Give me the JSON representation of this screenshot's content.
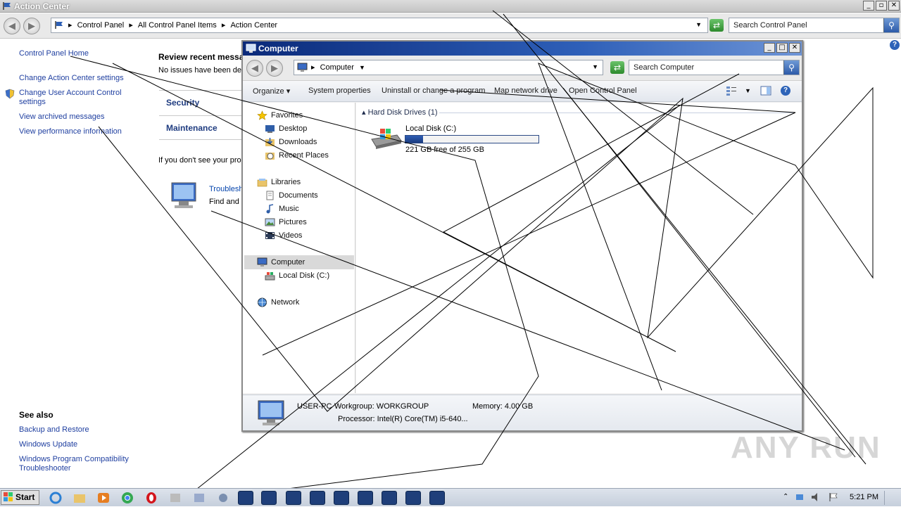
{
  "ac_window": {
    "title": "Action Center",
    "breadcrumbs": [
      "Control Panel",
      "All Control Panel Items",
      "Action Center"
    ],
    "search_placeholder": "Search Control Panel",
    "left_links": {
      "home": "Control Panel Home",
      "change_settings": "Change Action Center settings",
      "uac": "Change User Account Control settings",
      "archived": "View archived messages",
      "performance": "View performance information"
    },
    "see_also": {
      "title": "See also",
      "backup": "Backup and Restore",
      "update": "Windows Update",
      "compat": "Windows Program Compatibility Troubleshooter"
    },
    "main": {
      "review_title": "Review recent messa",
      "no_issues": "No issues have been det",
      "security": "Security",
      "maintenance": "Maintenance",
      "dont_see": "If you don't see your pro",
      "troubleshoot_title": "Troublesh",
      "troubleshoot_desc": "Find and"
    }
  },
  "computer_window": {
    "title": "Computer",
    "address": "Computer",
    "search_placeholder": "Search Computer",
    "toolbar": {
      "organize": "Organize",
      "system_properties": "System properties",
      "uninstall": "Uninstall or change a program",
      "map_drive": "Map network drive",
      "open_cp": "Open Control Panel"
    },
    "nav": {
      "favorites": "Favorites",
      "desktop": "Desktop",
      "downloads": "Downloads",
      "recent": "Recent Places",
      "libraries": "Libraries",
      "documents": "Documents",
      "music": "Music",
      "pictures": "Pictures",
      "videos": "Videos",
      "computer": "Computer",
      "local_disk": "Local Disk (C:)",
      "network": "Network"
    },
    "group_header": "Hard Disk Drives (1)",
    "drive": {
      "name": "Local Disk (C:)",
      "free_text": "221 GB free of 255 GB",
      "used_fraction": 0.13
    },
    "details": {
      "pc_name": "USER-PC",
      "workgroup": "Workgroup: WORKGROUP",
      "memory": "Memory: 4.00 GB",
      "processor": "Processor: Intel(R) Core(TM) i5-640..."
    }
  },
  "taskbar": {
    "start": "Start",
    "clock": "5:21 PM"
  },
  "watermark": "ANY RUN"
}
